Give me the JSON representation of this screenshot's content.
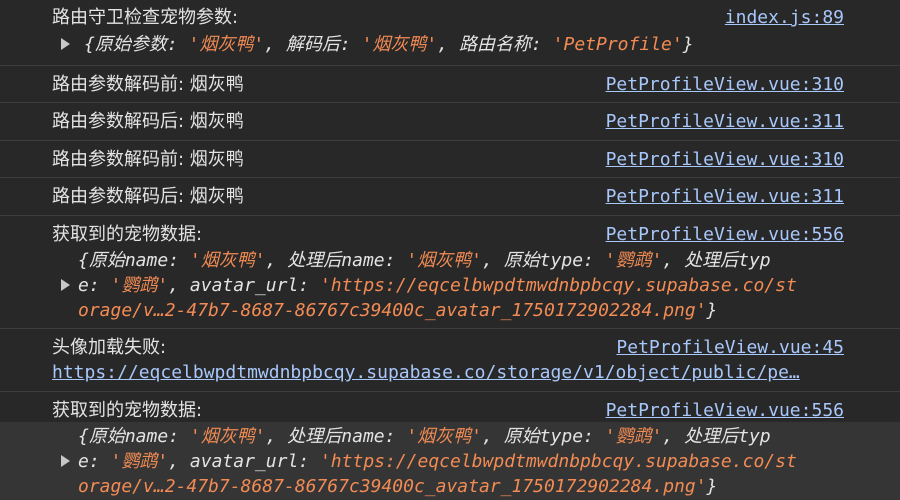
{
  "entries": [
    {
      "message": "路由守卫检查宠物参数:",
      "source": "index.js:89",
      "object": {
        "k1": "原始参数",
        "v1": "'烟灰鸭'",
        "k2": "解码后",
        "v2": "'烟灰鸭'",
        "k3": "路由名称",
        "v3": "'PetProfile'"
      }
    },
    {
      "message": "路由参数解码前: 烟灰鸭",
      "source": "PetProfileView.vue:310"
    },
    {
      "message": "路由参数解码后: 烟灰鸭",
      "source": "PetProfileView.vue:311"
    },
    {
      "message": "路由参数解码前: 烟灰鸭",
      "source": "PetProfileView.vue:310"
    },
    {
      "message": "路由参数解码后: 烟灰鸭",
      "source": "PetProfileView.vue:311"
    },
    {
      "message": "获取到的宠物数据:",
      "source": "PetProfileView.vue:556",
      "lines": {
        "k1": "原始name",
        "v1": "'烟灰鸭'",
        "k2": "处理后name",
        "v2": "'烟灰鸭'",
        "k3": "原始type",
        "v3": "'鹦鹉'",
        "k4a": "处理后typ",
        "k4b": "e",
        "v4": "'鹦鹉'",
        "k5": "avatar_url",
        "v5a": "'https://eqcelbwpdtmwdnbpbcqy.supabase.co/st",
        "v5b": "orage/v…2-47b7-8687-86767c39400c_avatar_1750172902284.png'"
      }
    },
    {
      "message": "头像加载失败:",
      "source": "PetProfileView.vue:45",
      "url": "https://eqcelbwpdtmwdnbpbcqy.supabase.co/storage/v1/object/public/pe…"
    },
    {
      "message": "获取到的宠物数据:",
      "source": "PetProfileView.vue:556",
      "lines": {
        "k1": "原始name",
        "v1": "'烟灰鸭'",
        "k2": "处理后name",
        "v2": "'烟灰鸭'",
        "k3": "原始type",
        "v3": "'鹦鹉'",
        "k4a": "处理后typ",
        "k4b": "e",
        "v4": "'鹦鹉'",
        "k5": "avatar_url",
        "v5a": "'https://eqcelbwpdtmwdnbpbcqy.supabase.co/st",
        "v5b": "orage/v…2-47b7-8687-86767c39400c_avatar_1750172902284.png'"
      }
    }
  ]
}
